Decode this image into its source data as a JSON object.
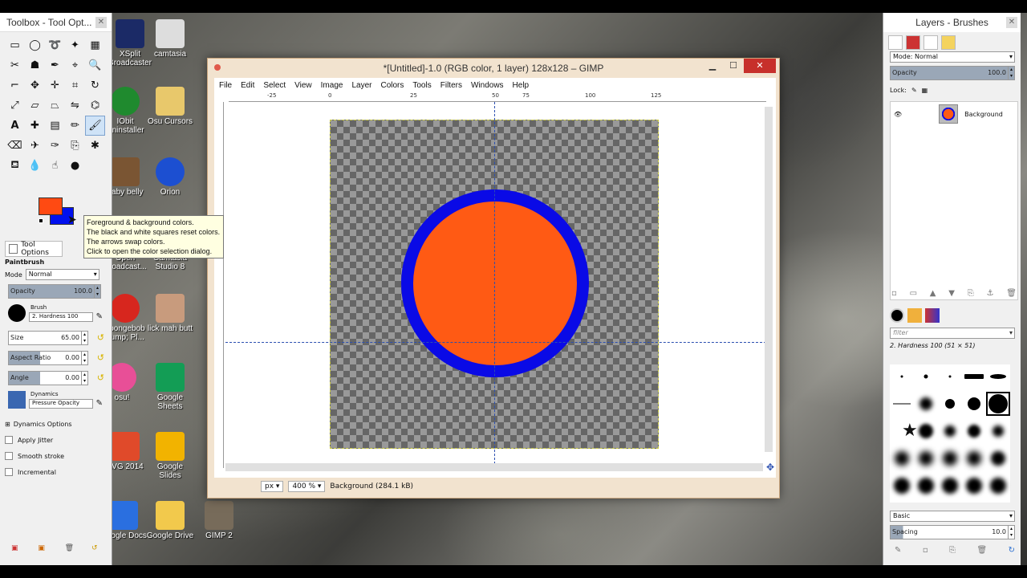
{
  "desktop": {
    "icons": [
      {
        "label": "XSplit\nBroadcaster",
        "name": "xsplit"
      },
      {
        "label": "camtasia",
        "name": "camtasia"
      },
      {
        "label": "IObit\nUninstaller",
        "name": "iobit"
      },
      {
        "label": "Osu Cursors",
        "name": "osu-cursors"
      },
      {
        "label": "baby belly",
        "name": "baby-belly"
      },
      {
        "label": "Orion",
        "name": "orion"
      },
      {
        "label": "Open\nBroadcast...",
        "name": "obs"
      },
      {
        "label": "Camtasia\nStudio 8",
        "name": "camtasia-studio"
      },
      {
        "label": "spongebob\nbump; Pl...",
        "name": "spongebob"
      },
      {
        "label": "lick mah butt",
        "name": "photo"
      },
      {
        "label": "osu!",
        "name": "osu"
      },
      {
        "label": "Google\nSheets",
        "name": "google-sheets"
      },
      {
        "label": "AVG 2014",
        "name": "avg"
      },
      {
        "label": "Google Slides",
        "name": "google-slides"
      },
      {
        "label": "Google Docs",
        "name": "google-docs"
      },
      {
        "label": "Google Drive",
        "name": "google-drive"
      },
      {
        "label": "GIMP 2",
        "name": "gimp"
      }
    ]
  },
  "toolbox": {
    "title": "Toolbox - Tool Opt...",
    "tooltip": [
      "Foreground & background colors.",
      "The black and white squares reset colors.",
      "The arrows swap colors.",
      "Click to open the color selection dialog."
    ],
    "fg_color": "#ff4a12",
    "bg_color": "#0010ee",
    "tab_label": "Tool Options",
    "tool_name": "Paintbrush",
    "mode_label": "Mode",
    "mode_value": "Normal",
    "opacity_label": "Opacity",
    "opacity_value": "100.0",
    "brush_label": "Brush",
    "brush_value": "2. Hardness 100",
    "size_label": "Size",
    "size_value": "65.00",
    "aspect_label": "Aspect Ratio",
    "aspect_value": "0.00",
    "angle_label": "Angle",
    "angle_value": "0.00",
    "dynamics_label": "Dynamics",
    "dynamics_value": "Pressure Opacity",
    "dynamics_options": "Dynamics Options",
    "apply_jitter": "Apply Jitter",
    "smooth_stroke": "Smooth stroke",
    "incremental": "Incremental"
  },
  "image_window": {
    "title": "*[Untitled]-1.0 (RGB color, 1 layer) 128x128 – GIMP",
    "menu": [
      "File",
      "Edit",
      "Select",
      "View",
      "Image",
      "Layer",
      "Colors",
      "Tools",
      "Filters",
      "Windows",
      "Help"
    ],
    "ruler_ticks": [
      "0",
      "25",
      "50",
      "75",
      "100",
      "125"
    ],
    "unit": "px",
    "zoom": "400 %",
    "status": "Background (284.1 kB)",
    "circle_fill": "#ff5a14",
    "circle_stroke": "#0a0ae6"
  },
  "layers_dock": {
    "title": "Layers - Brushes",
    "mode_label": "Mode: Normal",
    "opacity_label": "Opacity",
    "opacity_value": "100.0",
    "lock_label": "Lock:",
    "layer_name": "Background",
    "filter_placeholder": "filter",
    "brush_name": "2. Hardness 100 (51 × 51)",
    "brush_set": "Basic",
    "spacing_label": "Spacing",
    "spacing_value": "10.0"
  }
}
